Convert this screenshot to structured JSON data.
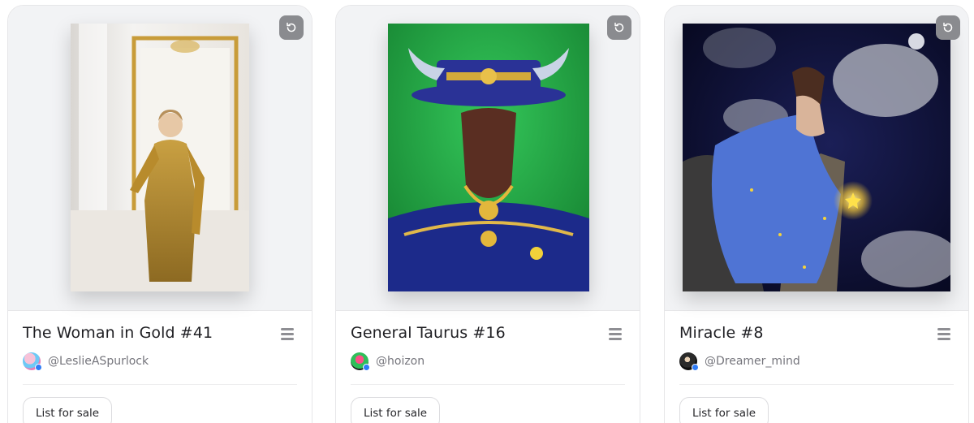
{
  "cards": [
    {
      "title": "The Woman in Gold #41",
      "creator": "@LeslieASpurlock",
      "action_label": "List for sale",
      "icons": [
        "refresh-icon",
        "menu-icon",
        "verified-badge-icon"
      ],
      "accent_colors": [
        "#b88b2c",
        "#f2f0ed"
      ]
    },
    {
      "title": "General Taurus #16",
      "creator": "@hoizon",
      "action_label": "List for sale",
      "icons": [
        "refresh-icon",
        "menu-icon",
        "verified-badge-icon"
      ],
      "accent_colors": [
        "#1e9e3a",
        "#23338f",
        "#c9a233"
      ]
    },
    {
      "title": "Miracle #8",
      "creator": "@Dreamer_mind",
      "action_label": "List for sale",
      "icons": [
        "refresh-icon",
        "menu-icon",
        "verified-badge-icon"
      ],
      "accent_colors": [
        "#0d0f33",
        "#4a6fd1",
        "#f5d33a"
      ]
    }
  ]
}
